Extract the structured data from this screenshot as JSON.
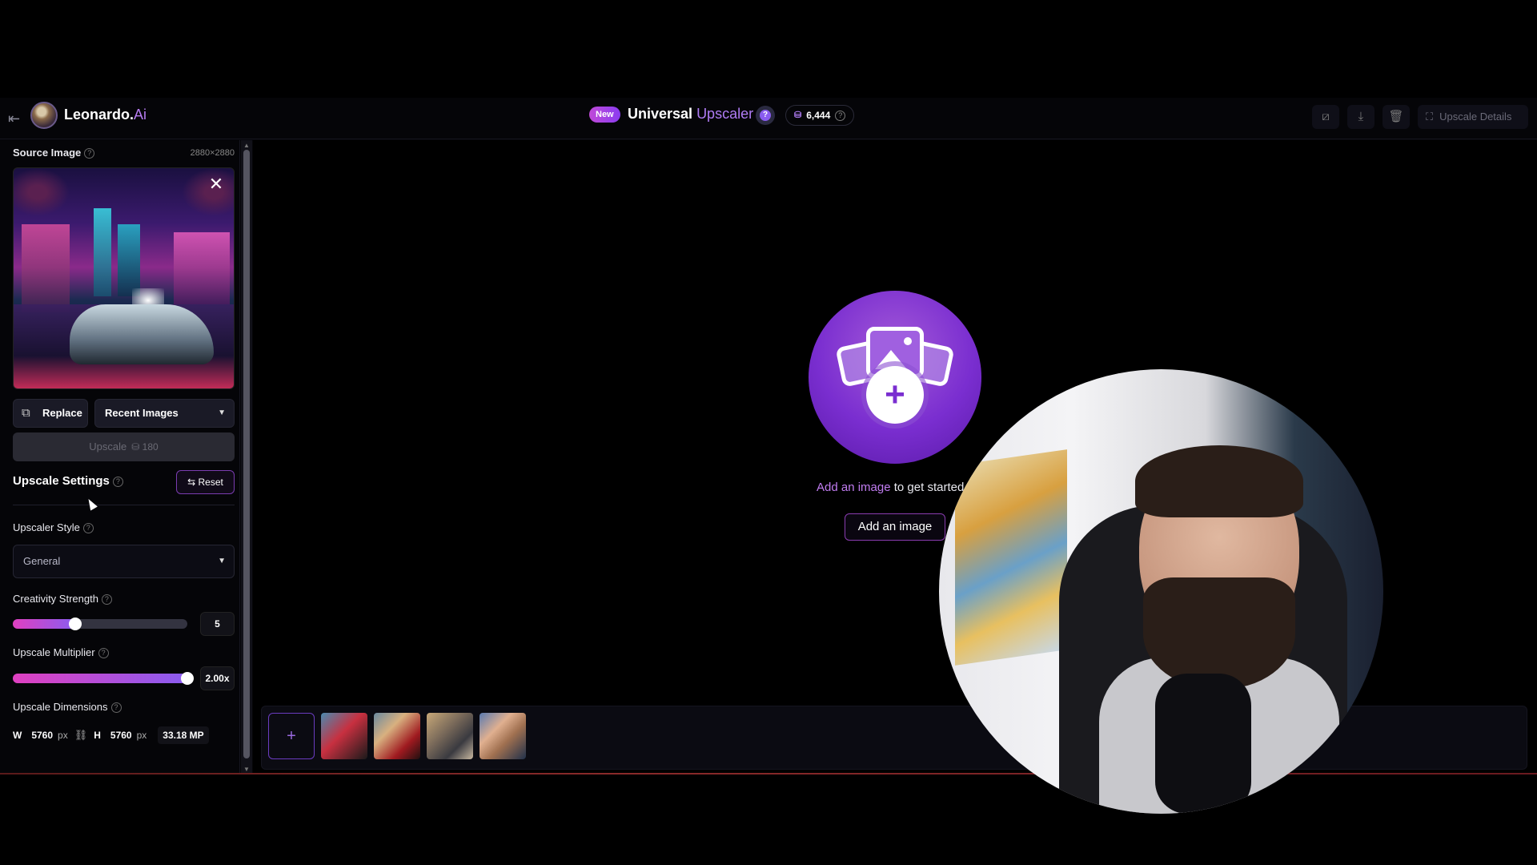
{
  "header": {
    "brand_name": "Leonardo.",
    "brand_suffix": "Ai",
    "new_badge": "New",
    "title_main": "Universal",
    "title_accent": "Upscaler",
    "credits": "6,444",
    "upscale_details_label": "Upscale Details"
  },
  "sidebar": {
    "source_image_label": "Source Image",
    "source_image_dims": "2880×2880",
    "replace_label": "Replace",
    "recent_images_label": "Recent Images",
    "upscale_label": "Upscale",
    "upscale_cost": "180",
    "settings_title": "Upscale Settings",
    "reset_label": "Reset",
    "upscaler_style_label": "Upscaler Style",
    "upscaler_style_value": "General",
    "creativity_label": "Creativity Strength",
    "creativity_value": "5",
    "creativity_fraction": 0.36,
    "multiplier_label": "Upscale Multiplier",
    "multiplier_value": "2.00x",
    "multiplier_fraction": 1.0,
    "dimensions_label": "Upscale Dimensions",
    "width_key": "W",
    "width_value": "5760",
    "height_key": "H",
    "height_value": "5760",
    "unit": "px",
    "megapixels": "33.18",
    "mp_unit": "MP"
  },
  "main": {
    "add_image_link": "Add an image",
    "get_started_text": "to get started",
    "add_image_button": "Add an image"
  },
  "colors": {
    "accent": "#b07cf5",
    "gradient_start": "#e040c0",
    "gradient_end": "#8a5cf0"
  }
}
